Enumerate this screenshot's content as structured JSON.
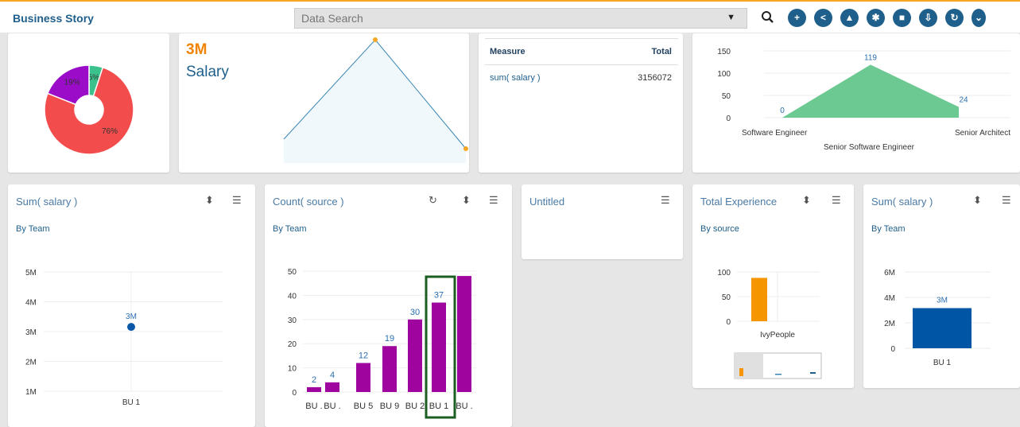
{
  "app": {
    "title": "Business Story"
  },
  "search": {
    "placeholder": "Data Search"
  },
  "toolbar": [
    {
      "name": "search-icon"
    },
    {
      "name": "add-icon"
    },
    {
      "name": "share-icon"
    },
    {
      "name": "notification-bell-icon"
    },
    {
      "name": "settings-gear-icon"
    },
    {
      "name": "save-icon"
    },
    {
      "name": "export-icon"
    },
    {
      "name": "refresh-icon"
    },
    {
      "name": "more-icon"
    }
  ],
  "colors": {
    "brand": "#1f5f8b",
    "accent_orange": "#f5a623",
    "purple": "#a0049f",
    "green": "#5dc386",
    "red": "#f24c4c",
    "blue_bar": "#0055a5"
  },
  "kpi": {
    "value": "3M",
    "label": "Salary"
  },
  "measure_table": {
    "headers": [
      "Measure",
      "Total"
    ],
    "rows": [
      [
        "sum( salary )",
        "3156072"
      ]
    ]
  },
  "widgets": [
    {
      "title": "Sum( salary )",
      "subtitle": "By Team"
    },
    {
      "title": "Count( source )",
      "subtitle": "By Team"
    },
    {
      "title": "Untitled"
    },
    {
      "title": "Total Experience",
      "subtitle": "By source"
    },
    {
      "title": "Sum( salary )",
      "subtitle": "By Team"
    }
  ],
  "chart_data": [
    {
      "type": "pie",
      "labels": [
        "76%",
        "19%",
        "5%"
      ],
      "values": [
        76,
        19,
        5
      ],
      "colors": [
        "#f24c4c",
        "#9b0cc8",
        "#3bc18b"
      ]
    },
    {
      "type": "area",
      "values": [
        2,
        3,
        2
      ],
      "note_axes_hidden": true
    },
    {
      "type": "area",
      "categories": [
        "Software Engineer",
        "Senior Software Engineer",
        "Senior Architect"
      ],
      "values": [
        0,
        119,
        24
      ],
      "yticks": [
        "150",
        "100",
        "50",
        "0"
      ],
      "ylim": [
        0,
        150
      ]
    },
    {
      "type": "scatter",
      "categories": [
        "BU 1"
      ],
      "values": [
        3.156
      ],
      "value_labels": [
        "3M"
      ],
      "yticks": [
        "5M",
        "4M",
        "3M",
        "2M",
        "1M"
      ],
      "ylim": [
        1,
        5
      ]
    },
    {
      "type": "bar",
      "categories": [
        "BU .",
        "BU .",
        "BU 5",
        "BU 9",
        "BU 2",
        "BU 1",
        "BU ."
      ],
      "values": [
        2,
        4,
        12,
        19,
        30,
        37,
        48
      ],
      "value_labels": [
        "2",
        "4",
        "12",
        "19",
        "30",
        "37",
        ""
      ],
      "yticks": [
        "50",
        "40",
        "30",
        "20",
        "10",
        "0"
      ],
      "ylim": [
        0,
        50
      ]
    },
    {
      "type": "bar",
      "categories": [
        "IvyPeople"
      ],
      "values": [
        88
      ],
      "yticks": [
        "100",
        "50",
        "0"
      ],
      "ylim": [
        0,
        100
      ]
    },
    {
      "type": "bar",
      "categories": [
        "BU 1"
      ],
      "values": [
        3.156
      ],
      "value_labels": [
        "3M"
      ],
      "yticks": [
        "6M",
        "4M",
        "2M",
        "0"
      ],
      "ylim": [
        0,
        6
      ]
    }
  ]
}
